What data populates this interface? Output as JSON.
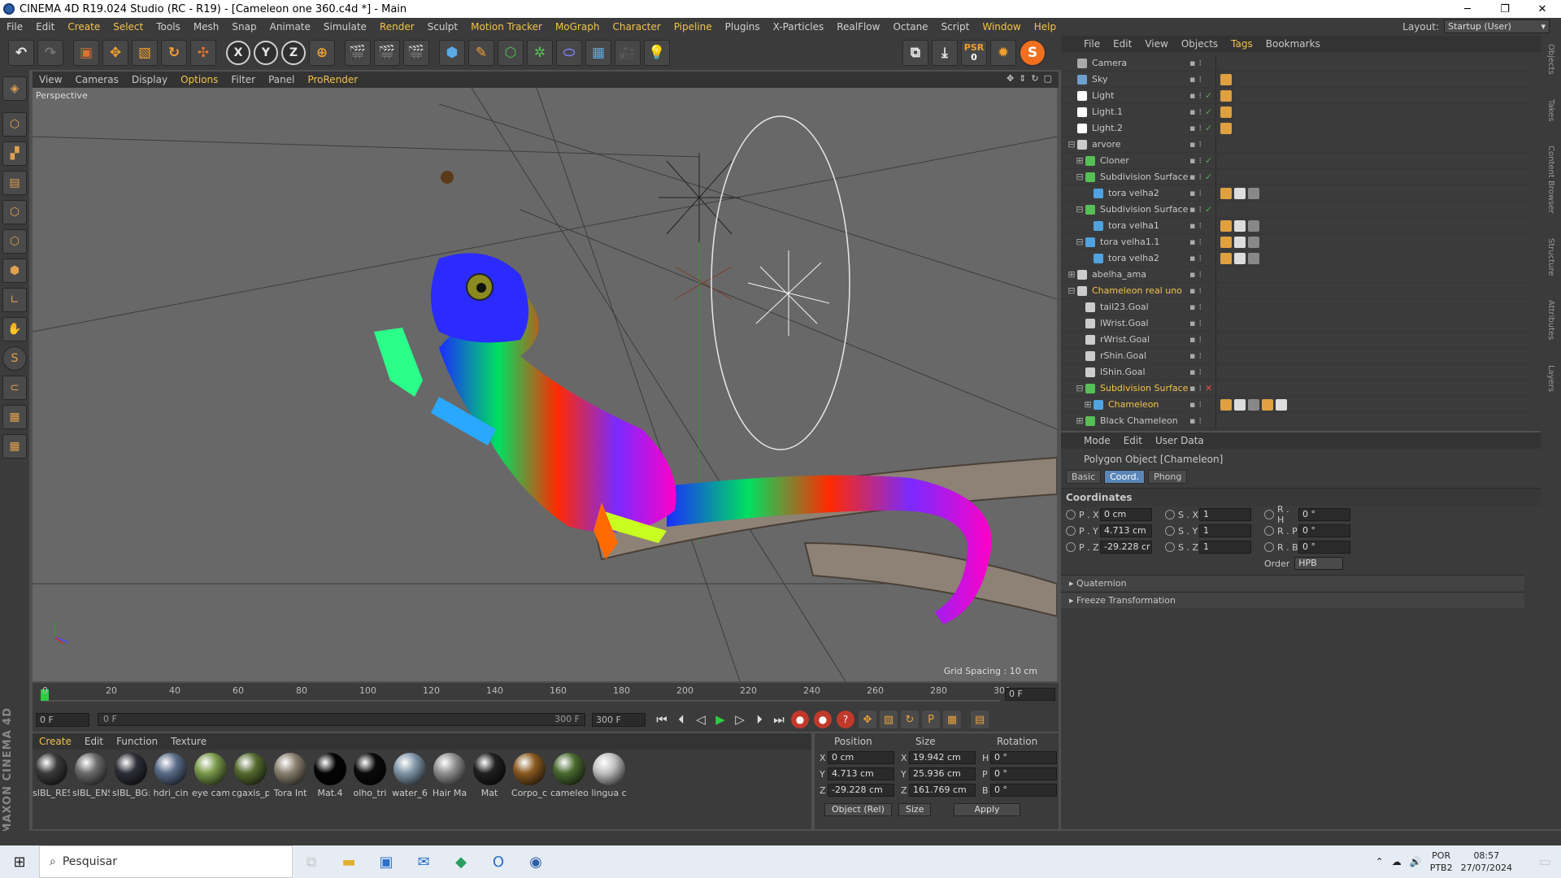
{
  "window": {
    "title": "CINEMA 4D R19.024 Studio (RC - R19) - [Cameleon one 360.c4d *] - Main"
  },
  "menubar": {
    "items": [
      "File",
      "Edit",
      "Create",
      "Select",
      "Tools",
      "Mesh",
      "Snap",
      "Animate",
      "Simulate",
      "Render",
      "Sculpt",
      "Motion Tracker",
      "MoGraph",
      "Character",
      "Pipeline",
      "Plugins",
      "X-Particles",
      "RealFlow",
      "Octane",
      "Script",
      "Window",
      "Help"
    ],
    "layout_label": "Layout:",
    "layout_value": "Startup (User)"
  },
  "toolbar": {
    "x": "X",
    "y": "Y",
    "z": "Z",
    "psr": "PSR",
    "psr_val": "0"
  },
  "viewport": {
    "menu": [
      "View",
      "Cameras",
      "Display",
      "Options",
      "Filter",
      "Panel",
      "ProRender"
    ],
    "label": "Perspective",
    "grid_spacing": "Grid Spacing : 10 cm"
  },
  "timeline": {
    "ticks": [
      "0",
      "20",
      "40",
      "60",
      "80",
      "100",
      "120",
      "140",
      "160",
      "180",
      "200",
      "220",
      "240",
      "260",
      "280",
      "300"
    ],
    "current_frame": "0 F",
    "start": "0 F",
    "slider_start": "0 F",
    "slider_end": "300 F",
    "end": "300 F"
  },
  "materials": {
    "menu": [
      "Create",
      "Edit",
      "Function",
      "Texture"
    ],
    "items": [
      {
        "name": "sIBL_RES",
        "color": "#3a3a3a"
      },
      {
        "name": "sIBL_ENS",
        "color": "#6b6b6b"
      },
      {
        "name": "sIBL_BG:",
        "color": "#2e2e3a"
      },
      {
        "name": "hdri_cin",
        "color": "#5a6c88"
      },
      {
        "name": "eye cam",
        "color": "#7a9a4a"
      },
      {
        "name": "cgaxis_p",
        "color": "#556b2f"
      },
      {
        "name": "Tora Int",
        "color": "#8a8070"
      },
      {
        "name": "Mat.4",
        "color": "#050505"
      },
      {
        "name": "olho_tri",
        "color": "#0a0a0a"
      },
      {
        "name": "water_6",
        "color": "#8096a8"
      },
      {
        "name": "Hair Ma",
        "color": "#909090"
      },
      {
        "name": "Mat",
        "color": "#202020"
      },
      {
        "name": "Corpo_c",
        "color": "#8a5a20"
      },
      {
        "name": "cameleo",
        "color": "#4a6a30"
      },
      {
        "name": "lingua c",
        "color": "#c0c0c0"
      }
    ]
  },
  "coords": {
    "headers": [
      "Position",
      "Size",
      "Rotation"
    ],
    "rows": [
      {
        "a": "X",
        "pos": "0 cm",
        "s": "X",
        "size": "19.942 cm",
        "r": "H",
        "rot": "0 °"
      },
      {
        "a": "Y",
        "pos": "4.713 cm",
        "s": "Y",
        "size": "25.936 cm",
        "r": "P",
        "rot": "0 °"
      },
      {
        "a": "Z",
        "pos": "-29.228 cm",
        "s": "Z",
        "size": "161.769 cm",
        "r": "B",
        "rot": "0 °"
      }
    ],
    "mode": "Object (Rel)",
    "size_mode": "Size",
    "apply": "Apply"
  },
  "objects": {
    "menu": [
      "File",
      "Edit",
      "View",
      "Objects",
      "Tags",
      "Bookmarks"
    ],
    "rows": [
      {
        "name": "Camera",
        "indent": 0,
        "exp": "",
        "icon": "#aaaaaa",
        "hl": false,
        "chk": ""
      },
      {
        "name": "Sky",
        "indent": 0,
        "exp": "",
        "icon": "#6fa0d0",
        "hl": false,
        "chk": ""
      },
      {
        "name": "Light",
        "indent": 0,
        "exp": "",
        "icon": "#ffffff",
        "hl": false,
        "chk": "✓"
      },
      {
        "name": "Light.1",
        "indent": 0,
        "exp": "",
        "icon": "#ffffff",
        "hl": false,
        "chk": "✓"
      },
      {
        "name": "Light.2",
        "indent": 0,
        "exp": "",
        "icon": "#ffffff",
        "hl": false,
        "chk": "✓"
      },
      {
        "name": "arvore",
        "indent": 0,
        "exp": "⊟",
        "icon": "#cccccc",
        "hl": false,
        "chk": ""
      },
      {
        "name": "Cloner",
        "indent": 1,
        "exp": "⊞",
        "icon": "#55c055",
        "hl": false,
        "chk": "✓"
      },
      {
        "name": "Subdivision Surface",
        "indent": 1,
        "exp": "⊟",
        "icon": "#55c055",
        "hl": false,
        "chk": "✓"
      },
      {
        "name": "tora velha2",
        "indent": 2,
        "exp": "",
        "icon": "#4fa3e0",
        "hl": false,
        "chk": ""
      },
      {
        "name": "Subdivision Surface",
        "indent": 1,
        "exp": "⊟",
        "icon": "#55c055",
        "hl": false,
        "chk": "✓"
      },
      {
        "name": "tora velha1",
        "indent": 2,
        "exp": "",
        "icon": "#4fa3e0",
        "hl": false,
        "chk": ""
      },
      {
        "name": "tora velha1.1",
        "indent": 1,
        "exp": "⊟",
        "icon": "#4fa3e0",
        "hl": false,
        "chk": ""
      },
      {
        "name": "tora velha2",
        "indent": 2,
        "exp": "",
        "icon": "#4fa3e0",
        "hl": false,
        "chk": ""
      },
      {
        "name": "abelha_ama",
        "indent": 0,
        "exp": "⊞",
        "icon": "#cccccc",
        "hl": false,
        "chk": ""
      },
      {
        "name": "Chameleon real uno",
        "indent": 0,
        "exp": "⊟",
        "icon": "#cccccc",
        "hl": true,
        "chk": ""
      },
      {
        "name": "tail23.Goal",
        "indent": 1,
        "exp": "",
        "icon": "#cccccc",
        "hl": false,
        "chk": ""
      },
      {
        "name": "lWrist.Goal",
        "indent": 1,
        "exp": "",
        "icon": "#cccccc",
        "hl": false,
        "chk": ""
      },
      {
        "name": "rWrist.Goal",
        "indent": 1,
        "exp": "",
        "icon": "#cccccc",
        "hl": false,
        "chk": ""
      },
      {
        "name": "rShin.Goal",
        "indent": 1,
        "exp": "",
        "icon": "#cccccc",
        "hl": false,
        "chk": ""
      },
      {
        "name": "lShin.Goal",
        "indent": 1,
        "exp": "",
        "icon": "#cccccc",
        "hl": false,
        "chk": ""
      },
      {
        "name": "Subdivision Surface",
        "indent": 1,
        "exp": "⊟",
        "icon": "#55c055",
        "hl": true,
        "chk": "✕"
      },
      {
        "name": "Chameleon",
        "indent": 2,
        "exp": "⊞",
        "icon": "#4fa3e0",
        "hl": true,
        "chk": ""
      },
      {
        "name": "Black Chameleon",
        "indent": 1,
        "exp": "⊞",
        "icon": "#55c055",
        "hl": false,
        "chk": ""
      }
    ]
  },
  "attributes": {
    "menu": [
      "Mode",
      "Edit",
      "User Data"
    ],
    "title": "Polygon Object [Chameleon]",
    "tabs": [
      "Basic",
      "Coord.",
      "Phong"
    ],
    "section": "Coordinates",
    "rows": [
      [
        {
          "l": "P . X",
          "v": "0 cm"
        },
        {
          "l": "S . X",
          "v": "1"
        },
        {
          "l": "R . H",
          "v": "0 °"
        }
      ],
      [
        {
          "l": "P . Y",
          "v": "4.713 cm"
        },
        {
          "l": "S . Y",
          "v": "1"
        },
        {
          "l": "R . P",
          "v": "0 °"
        }
      ],
      [
        {
          "l": "P . Z",
          "v": "-29.228 cr"
        },
        {
          "l": "S . Z",
          "v": "1"
        },
        {
          "l": "R . B",
          "v": "0 °"
        }
      ]
    ],
    "order_label": "Order",
    "order_value": "HPB",
    "collapsed": [
      "Quaternion",
      "Freeze Transformation"
    ]
  },
  "right_strip": [
    "Objects",
    "Takes",
    "Content Browser",
    "Structure",
    "Attributes",
    "Layers"
  ],
  "taskbar": {
    "search_placeholder": "Pesquisar",
    "lang1": "POR",
    "lang2": "PTB2",
    "time": "08:57",
    "date": "27/07/2024"
  }
}
